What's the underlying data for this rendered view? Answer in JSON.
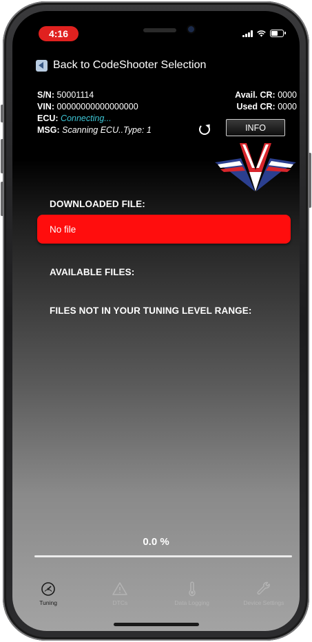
{
  "status_bar": {
    "time": "4:16"
  },
  "back_nav": {
    "label": "Back to CodeShooter Selection"
  },
  "device_info": {
    "sn_label": "S/N:",
    "sn_value": "50001114",
    "vin_label": "VIN:",
    "vin_value": "00000000000000000",
    "ecu_label": "ECU:",
    "ecu_value": "Connecting...",
    "msg_label": "MSG:",
    "msg_value": "Scanning ECU..Type: 1",
    "avail_cr_label": "Avail. CR:",
    "avail_cr_value": "0000",
    "used_cr_label": "Used CR:",
    "used_cr_value": "0000"
  },
  "info_button": {
    "label": "INFO"
  },
  "sections": {
    "downloaded_label": "DOWNLOADED FILE:",
    "downloaded_value": "No file",
    "available_label": "AVAILABLE FILES:",
    "out_of_range_label": "FILES NOT IN YOUR TUNING LEVEL RANGE:"
  },
  "progress": {
    "text": "0.0 %",
    "fraction": 0.0
  },
  "tabs": [
    {
      "label": "Tuning",
      "icon": "gauge-icon",
      "active": true
    },
    {
      "label": "DTCs",
      "icon": "warning-icon",
      "active": false
    },
    {
      "label": "Data Logging",
      "icon": "thermometer-icon",
      "active": false
    },
    {
      "label": "Device Settings",
      "icon": "wrench-icon",
      "active": false
    }
  ],
  "colors": {
    "accent_red": "#ff0d0d",
    "status_cyan": "#3ec6d6",
    "time_pill": "#e0211f"
  }
}
